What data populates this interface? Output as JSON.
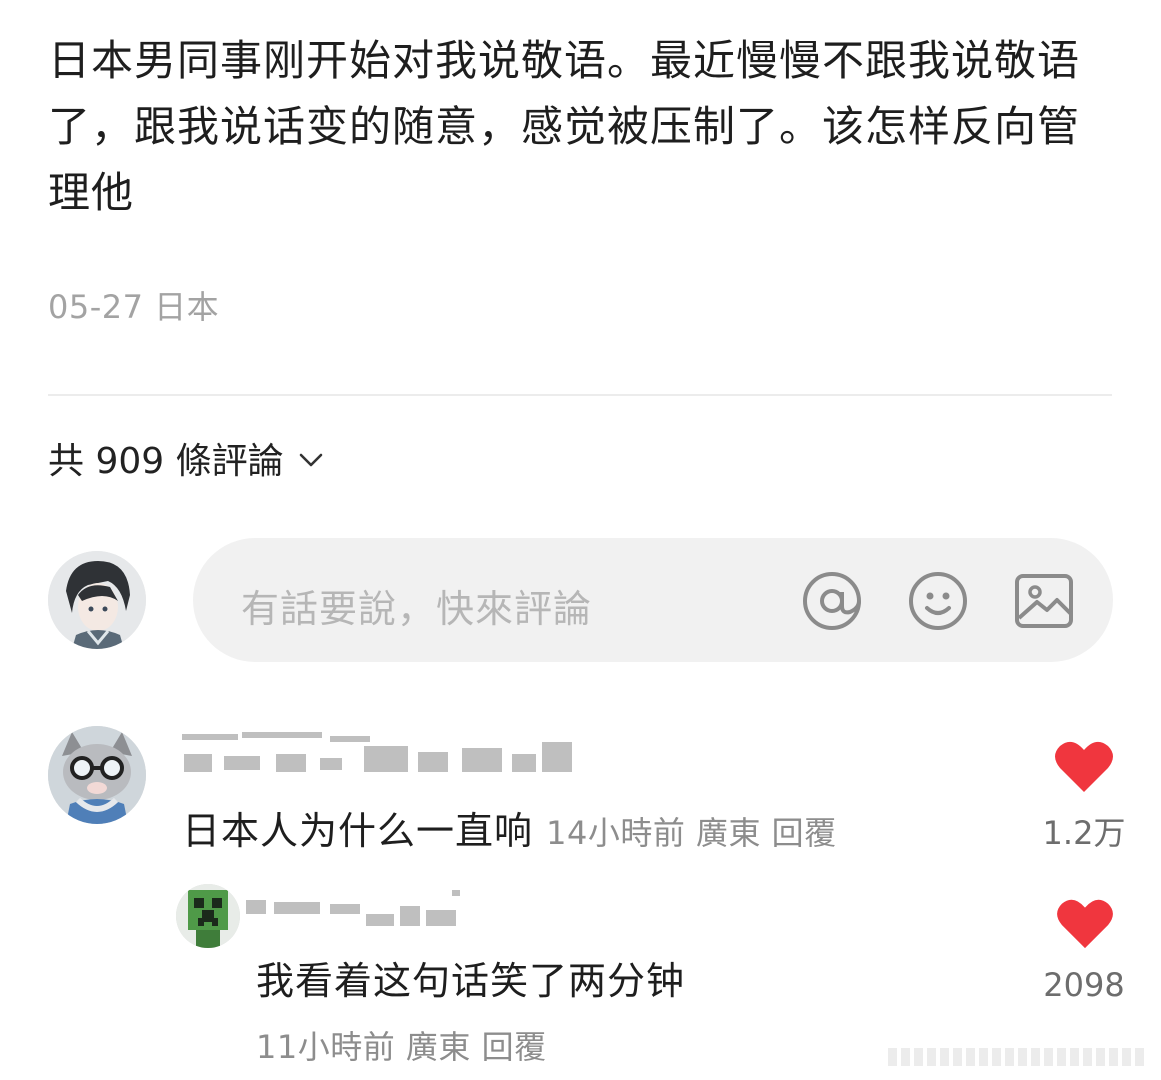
{
  "post": {
    "text": "日本男同事刚开始对我说敬语。最近慢慢不跟我说敬语了，跟我说话变的随意，感觉被压制了。该怎样反向管理他",
    "meta": "05-27 日本"
  },
  "comments_header": {
    "count_label": "共 909 條評論",
    "chevron_icon": "chevron-down-icon"
  },
  "input": {
    "placeholder": "有話要說，快來評論",
    "icons": [
      "at-icon",
      "emoji-icon",
      "image-icon"
    ]
  },
  "comments": [
    {
      "text": "日本人为什么一直响",
      "meta": "14小時前 廣東 回覆",
      "likes": "1.2万"
    }
  ],
  "replies": [
    {
      "text": "我看着这句话笑了两分钟",
      "meta": "11小時前 廣東 回覆",
      "likes": "2098"
    }
  ],
  "colors": {
    "heart": "#f0363e",
    "placeholder": "#b6b6b6",
    "meta": "#8d8d8d"
  }
}
